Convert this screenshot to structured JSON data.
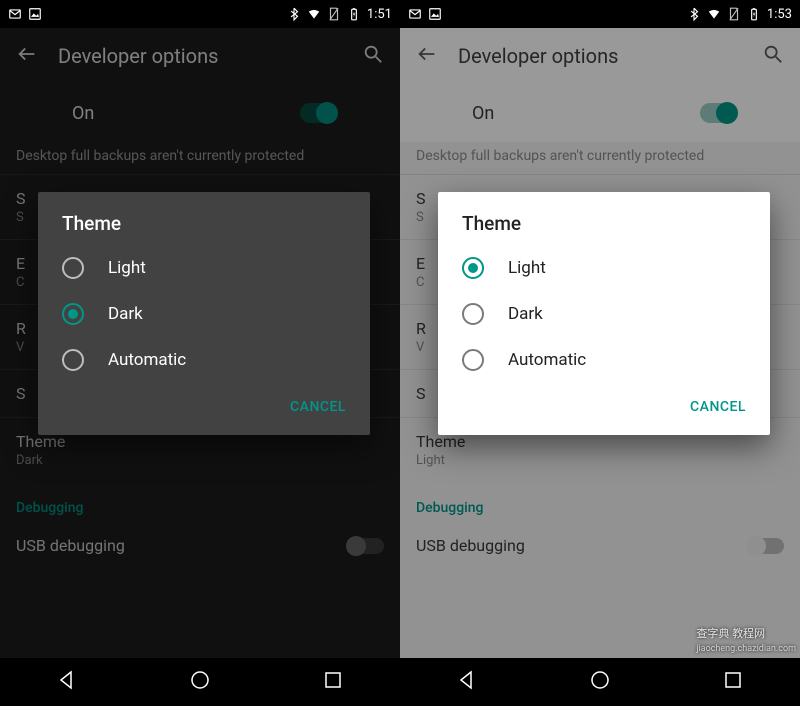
{
  "left": {
    "status_time": "1:51",
    "app_title": "Developer options",
    "toggle_label": "On",
    "backup_text": "Desktop full backups aren't currently protected",
    "theme_row_primary": "Theme",
    "theme_row_secondary": "Dark",
    "debugging_header": "Debugging",
    "usb_label": "USB debugging",
    "dialog_title": "Theme",
    "options": {
      "o1": "Light",
      "o2": "Dark",
      "o3": "Automatic"
    },
    "selected": "Dark",
    "cancel": "CANCEL",
    "partial_s": "S",
    "partial_e": "E",
    "partial_c": "C",
    "partial_r": "R",
    "partial_v": "V"
  },
  "right": {
    "status_time": "1:53",
    "app_title": "Developer options",
    "toggle_label": "On",
    "backup_text": "Desktop full backups aren't currently protected",
    "theme_row_primary": "Theme",
    "theme_row_secondary": "Light",
    "debugging_header": "Debugging",
    "usb_label": "USB debugging",
    "dialog_title": "Theme",
    "options": {
      "o1": "Light",
      "o2": "Dark",
      "o3": "Automatic"
    },
    "selected": "Light",
    "cancel": "CANCEL",
    "partial_s": "S",
    "partial_e": "E",
    "partial_c": "C",
    "partial_r": "R",
    "partial_v": "V"
  },
  "watermark": {
    "line1": "查字典",
    "line2": "教程网",
    "line3": "jiaocheng.chazidian.com"
  }
}
